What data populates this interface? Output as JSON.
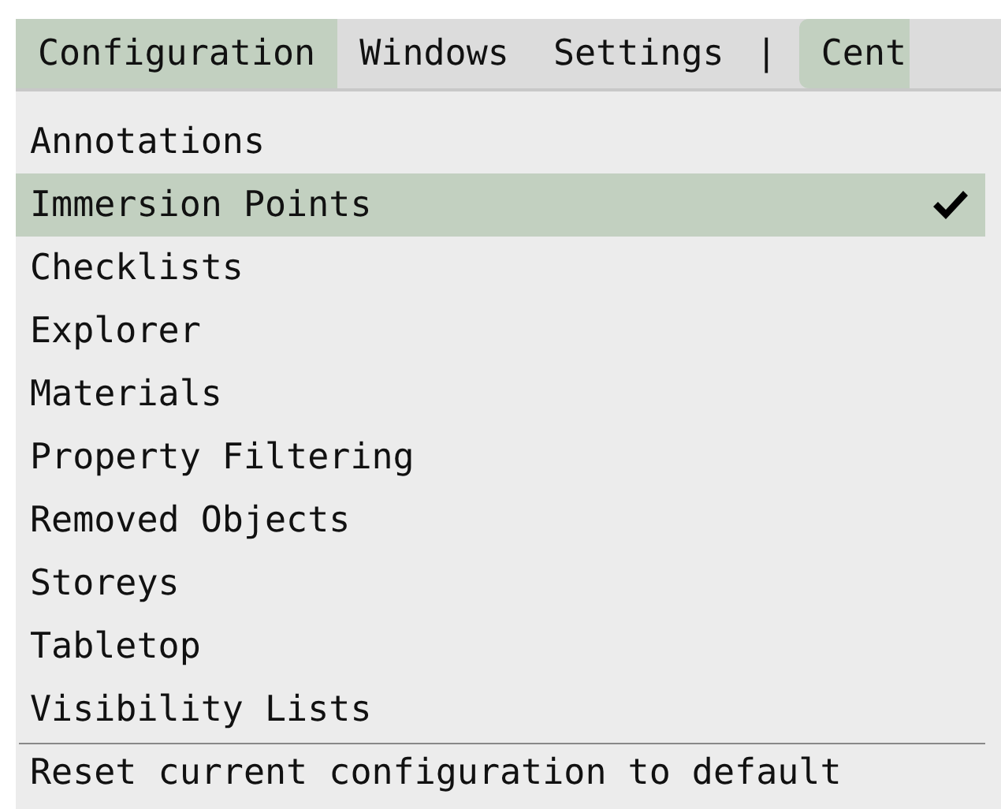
{
  "menu_bar": [
    {
      "kind": "menu",
      "label": "Configuration",
      "selected": true
    },
    {
      "kind": "menu",
      "label": "Windows",
      "selected": false
    },
    {
      "kind": "menu",
      "label": "Settings",
      "selected": false
    },
    {
      "kind": "separator",
      "label": "|"
    },
    {
      "kind": "menu",
      "label": "Cent",
      "selected": true
    }
  ],
  "dropdown": {
    "items": [
      {
        "label": "Annotations",
        "selected": false,
        "checked": false
      },
      {
        "label": "Immersion Points",
        "selected": true,
        "checked": true
      },
      {
        "label": "Checklists",
        "selected": false,
        "checked": false
      },
      {
        "label": "Explorer",
        "selected": false,
        "checked": false
      },
      {
        "label": "Materials",
        "selected": false,
        "checked": false
      },
      {
        "label": "Property Filtering",
        "selected": false,
        "checked": false
      },
      {
        "label": "Removed Objects",
        "selected": false,
        "checked": false
      },
      {
        "label": "Storeys",
        "selected": false,
        "checked": false
      },
      {
        "label": "Tabletop",
        "selected": false,
        "checked": false
      },
      {
        "label": "Visibility Lists",
        "selected": false,
        "checked": false
      }
    ],
    "footer_action": "Reset current configuration to default"
  }
}
